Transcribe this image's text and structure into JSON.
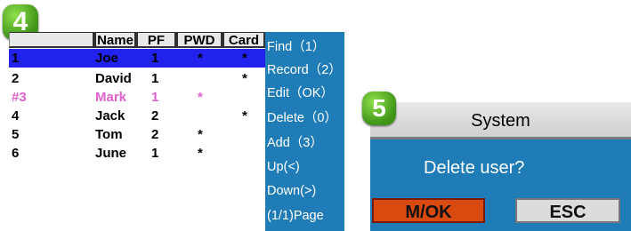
{
  "list_screen": {
    "badge": "4",
    "headers": [
      "Name",
      "PF",
      "PWD",
      "Card"
    ],
    "rows": [
      {
        "num": "1",
        "name": "Joe",
        "pf": "1",
        "pwd": "*",
        "card": "*"
      },
      {
        "num": "2",
        "name": "David",
        "pf": "1",
        "pwd": "",
        "card": "*"
      },
      {
        "num": "#3",
        "name": "Mark",
        "pf": "1",
        "pwd": "*",
        "card": ""
      },
      {
        "num": "4",
        "name": "Jack",
        "pf": "2",
        "pwd": "",
        "card": "*"
      },
      {
        "num": "5",
        "name": "Tom",
        "pf": "2",
        "pwd": "*",
        "card": ""
      },
      {
        "num": "6",
        "name": "June",
        "pf": "1",
        "pwd": "*",
        "card": ""
      }
    ],
    "menu": [
      "Find（1）",
      "Record（2）",
      "Edit（OK）",
      "Delete（0）",
      "Add（3）",
      "Up(<)",
      "Down(>)",
      "(1/1)Page"
    ]
  },
  "dialog": {
    "badge": "5",
    "title": "System",
    "message": "Delete user?",
    "ok_label": "M/OK",
    "esc_label": "ESC"
  },
  "colors": {
    "selection": "#2222ee",
    "panel_blue": "#1f7cb6",
    "pink_text": "#e060d0",
    "ok_button": "#d84a10",
    "badge_green": "#5cb82a"
  }
}
